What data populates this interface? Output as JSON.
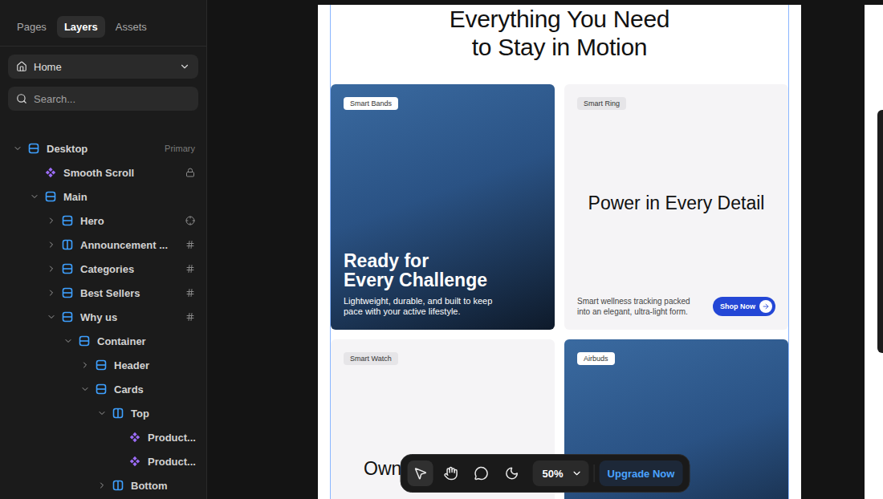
{
  "panel": {
    "tabs": [
      {
        "label": "Pages",
        "selected": false
      },
      {
        "label": "Layers",
        "selected": true
      },
      {
        "label": "Assets",
        "selected": false
      }
    ],
    "page": {
      "label": "Home"
    },
    "search": {
      "placeholder": "Search..."
    },
    "layers": [
      {
        "name": "Desktop",
        "depth": 0,
        "kind": "frame",
        "expandable": true,
        "expanded": true,
        "badge": "Primary",
        "trailing": "none"
      },
      {
        "name": "Smooth Scroll",
        "depth": 1,
        "kind": "component",
        "expandable": false,
        "expanded": false,
        "badge": "",
        "trailing": "lock"
      },
      {
        "name": "Main",
        "depth": 1,
        "kind": "frame",
        "expandable": true,
        "expanded": true,
        "badge": "",
        "trailing": "none"
      },
      {
        "name": "Hero",
        "depth": 2,
        "kind": "frame",
        "expandable": true,
        "expanded": false,
        "badge": "",
        "trailing": "target"
      },
      {
        "name": "Announcement ...",
        "depth": 2,
        "kind": "stack",
        "expandable": true,
        "expanded": false,
        "badge": "",
        "trailing": "hash"
      },
      {
        "name": "Categories",
        "depth": 2,
        "kind": "frame",
        "expandable": true,
        "expanded": false,
        "badge": "",
        "trailing": "hash"
      },
      {
        "name": "Best Sellers",
        "depth": 2,
        "kind": "frame",
        "expandable": true,
        "expanded": false,
        "badge": "",
        "trailing": "hash"
      },
      {
        "name": "Why us",
        "depth": 2,
        "kind": "frame",
        "expandable": true,
        "expanded": true,
        "badge": "",
        "trailing": "hash"
      },
      {
        "name": "Container",
        "depth": 3,
        "kind": "frame",
        "expandable": true,
        "expanded": true,
        "badge": "",
        "trailing": "none"
      },
      {
        "name": "Header",
        "depth": 4,
        "kind": "frame",
        "expandable": true,
        "expanded": false,
        "badge": "",
        "trailing": "none"
      },
      {
        "name": "Cards",
        "depth": 4,
        "kind": "frame",
        "expandable": true,
        "expanded": true,
        "badge": "",
        "trailing": "none"
      },
      {
        "name": "Top",
        "depth": 5,
        "kind": "stack",
        "expandable": true,
        "expanded": true,
        "badge": "",
        "trailing": "none"
      },
      {
        "name": "Product...",
        "depth": 6,
        "kind": "component",
        "expandable": false,
        "expanded": false,
        "badge": "",
        "trailing": "none"
      },
      {
        "name": "Product...",
        "depth": 6,
        "kind": "component",
        "expandable": false,
        "expanded": false,
        "badge": "",
        "trailing": "none"
      },
      {
        "name": "Bottom",
        "depth": 5,
        "kind": "stack",
        "expandable": true,
        "expanded": false,
        "badge": "",
        "trailing": "none"
      }
    ]
  },
  "canvas": {
    "heading": [
      "Everything You Need",
      "to Stay in Motion"
    ],
    "cards": [
      {
        "kind": "photo",
        "tag": "Smart Bands",
        "title": [
          "Ready for",
          "Every Challenge"
        ],
        "description": "Lightweight, durable, and built to keep pace with your active lifestyle.",
        "button": ""
      },
      {
        "kind": "plain",
        "tag": "Smart Ring",
        "title": [
          "Power in Every Detail"
        ],
        "description": "Smart wellness tracking packed into an elegant, ultra-light form.",
        "button": "Shop Now"
      },
      {
        "kind": "plain",
        "tag": "Smart Watch",
        "title": [
          "Own Every Second"
        ],
        "description": "",
        "button": ""
      },
      {
        "kind": "photo",
        "tag": "Airbuds",
        "title": [],
        "description": "",
        "button": ""
      }
    ]
  },
  "toolbar": {
    "tools": [
      {
        "kind": "pointer",
        "selected": true
      },
      {
        "kind": "hand",
        "selected": false
      },
      {
        "kind": "comment",
        "selected": false
      },
      {
        "kind": "theme",
        "selected": false
      }
    ],
    "zoom": "50%",
    "upgrade": "Upgrade Now"
  }
}
